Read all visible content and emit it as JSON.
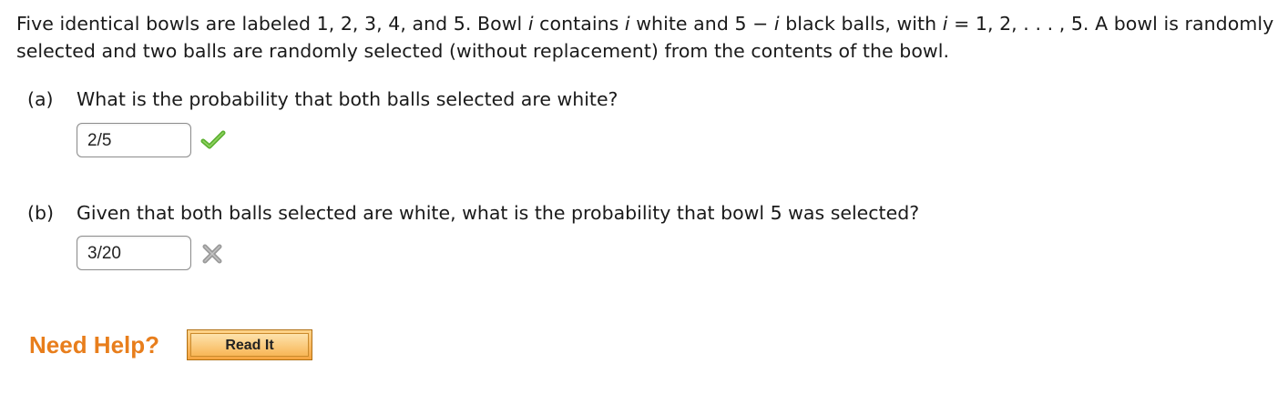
{
  "problem": {
    "text_1": "Five identical bowls are labeled 1, 2, 3, 4, and 5. Bowl ",
    "var_1": "i",
    "text_2": " contains ",
    "var_2": "i",
    "text_3": " white and 5 − ",
    "var_3": "i",
    "text_4": " black balls, with ",
    "var_4": "i",
    "text_5": " = 1, 2, . . . , 5. A bowl is randomly selected and two balls are randomly selected (without replacement) from the contents of the bowl."
  },
  "part_a": {
    "label": "(a)",
    "question": "What is the probability that both balls selected are white?",
    "answer_value": "2/5",
    "status": "correct",
    "status_icon": "check-icon",
    "status_color": "#5cb031"
  },
  "part_b": {
    "label": "(b)",
    "question": "Given that both balls selected are white, what is the probability that bowl 5 was selected?",
    "answer_value": "3/20",
    "status": "incorrect",
    "status_icon": "x-icon",
    "status_color": "#9a9a9a"
  },
  "help": {
    "label": "Need Help?",
    "label_color": "#e87e1c",
    "read_button": "Read It"
  }
}
